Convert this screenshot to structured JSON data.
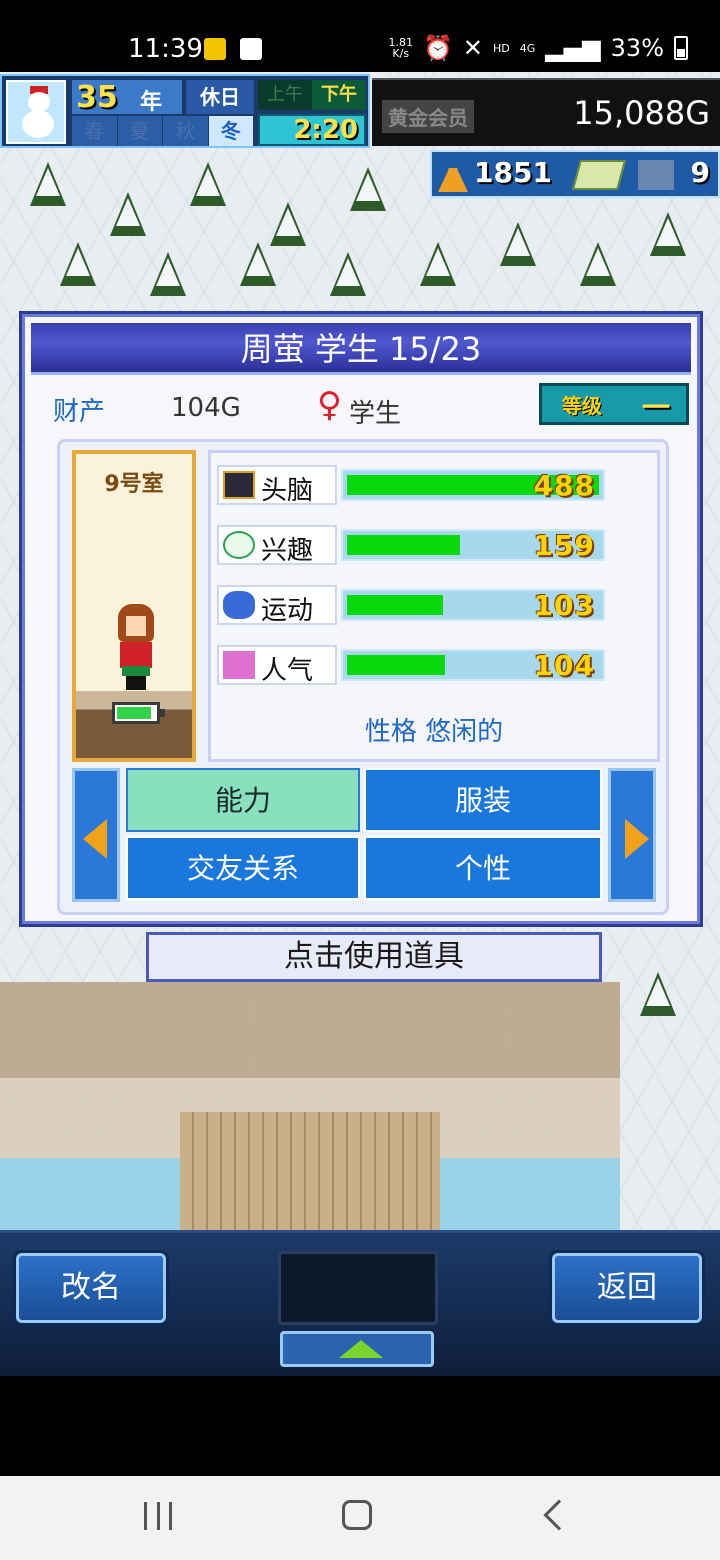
{
  "status_bar": {
    "time": "11:39",
    "net_speed_top": "1.81",
    "net_speed_unit": "K/s",
    "hd": "HD",
    "network": "4G",
    "battery": "33%"
  },
  "hud": {
    "year": "35",
    "year_unit": "年",
    "day_type": "休日",
    "seasons": [
      "春",
      "夏",
      "秋",
      "冬"
    ],
    "active_season": "冬",
    "ampm": [
      "上午",
      "下午"
    ],
    "active_ampm": "下午",
    "clock": "2:20",
    "member": "黄金会员",
    "money": "15,088G",
    "research_points": "1851",
    "tickets": "9"
  },
  "dialog": {
    "title": "周萤 学生 15/23",
    "assets_label": "财产",
    "assets_value": "104G",
    "gender_icon": "♀",
    "role": "学生",
    "level_label": "等级",
    "level_value": "一",
    "room": "9号室",
    "stats": [
      {
        "name": "头脑",
        "value": "488",
        "fill_pct": 100,
        "icon": "computer-icon"
      },
      {
        "name": "兴趣",
        "value": "159",
        "fill_pct": 45,
        "icon": "idea-bubble-icon"
      },
      {
        "name": "运动",
        "value": "103",
        "fill_pct": 38,
        "icon": "sport-icon"
      },
      {
        "name": "人气",
        "value": "104",
        "fill_pct": 39,
        "icon": "sparkle-icon"
      }
    ],
    "personality": "性格 悠闲的",
    "tabs": {
      "ability": "能力",
      "clothing": "服装",
      "friends": "交友关系",
      "personality": "个性"
    },
    "use_item": "点击使用道具"
  },
  "bottom_bar": {
    "rename": "改名",
    "back": "返回"
  },
  "colors": {
    "title_bar": "#3a3fb0",
    "stat_fill": "#0bd80b",
    "tab_active": "#88e0be",
    "tab_inactive": "#1a78dc",
    "accent_text": "#1e68c8"
  }
}
